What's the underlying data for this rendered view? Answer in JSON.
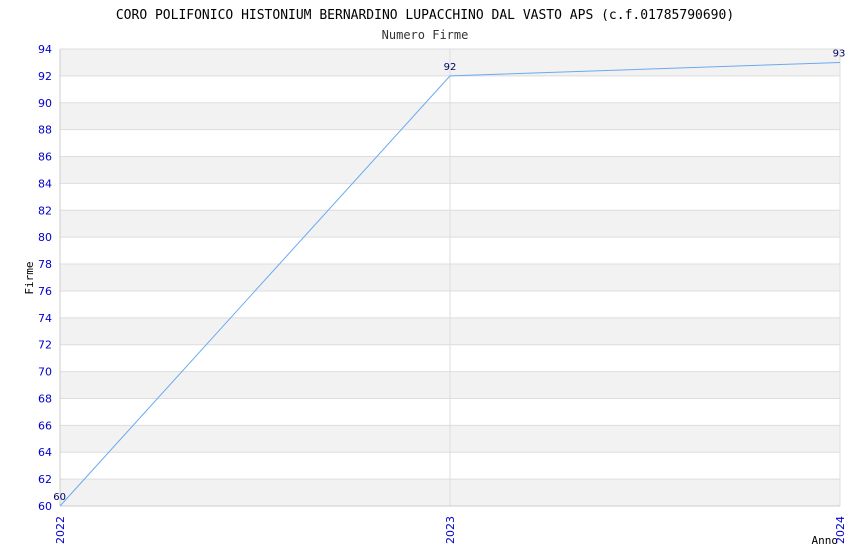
{
  "chart_data": {
    "type": "line",
    "title": "CORO POLIFONICO HISTONIUM BERNARDINO LUPACCHINO DAL VASTO APS (c.f.01785790690)",
    "subtitle": "Numero Firme",
    "xlabel": "Anno",
    "ylabel": "Firme",
    "x": [
      "2022",
      "2023",
      "2024"
    ],
    "series": [
      {
        "values": [
          60,
          92,
          93
        ]
      }
    ],
    "ylim": [
      60,
      94
    ],
    "yticks": [
      60,
      62,
      64,
      66,
      68,
      70,
      72,
      74,
      76,
      78,
      80,
      82,
      84,
      86,
      88,
      90,
      92,
      94
    ],
    "grid": true,
    "colors": {
      "line": "#6aaaf0",
      "band_alt": "#f2f2f2",
      "grid": "#dddddd",
      "tick_text": "#0000cc"
    }
  }
}
